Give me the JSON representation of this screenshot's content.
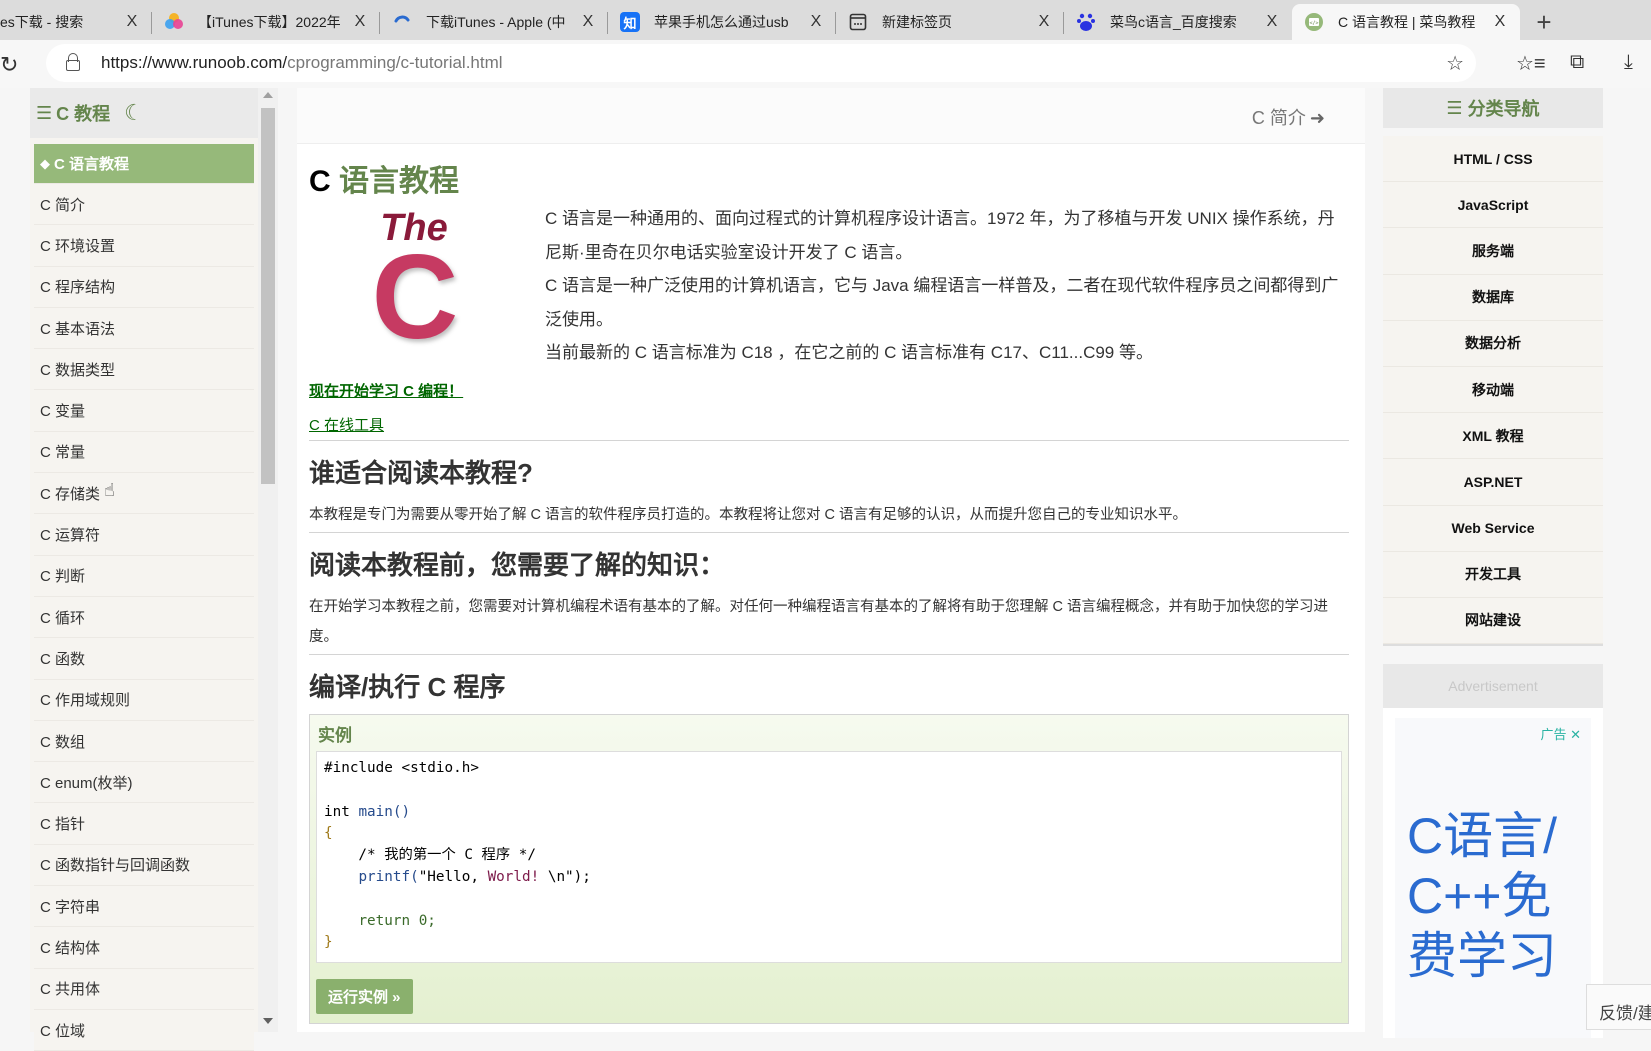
{
  "browser": {
    "tabs": [
      {
        "title": "es下载 - 搜索",
        "favicon": "search-favicon",
        "active": false
      },
      {
        "title": "【iTunes下载】2022年",
        "favicon": "colorful-app-favicon",
        "active": false
      },
      {
        "title": "下载iTunes - Apple (中",
        "favicon": "apple-favicon",
        "active": false
      },
      {
        "title": "苹果手机怎么通过usb",
        "favicon": "zhihu-favicon",
        "active": false
      },
      {
        "title": "新建标签页",
        "favicon": "new-tab-favicon",
        "active": false
      },
      {
        "title": "菜鸟c语言_百度搜索",
        "favicon": "baidu-favicon",
        "active": false
      },
      {
        "title": "C 语言教程 | 菜鸟教程",
        "favicon": "runoob-favicon",
        "active": true
      }
    ],
    "zhihu_glyph": "知",
    "close_glyph": "X",
    "new_tab_glyph": "+",
    "url_host": "https://www.runoob.com/",
    "url_path": "cprogramming/c-tutorial.html"
  },
  "left_nav": {
    "title": "C 教程",
    "items": [
      {
        "label": "C 语言教程",
        "active": true
      },
      {
        "label": "C 简介"
      },
      {
        "label": "C 环境设置"
      },
      {
        "label": "C 程序结构"
      },
      {
        "label": "C 基本语法"
      },
      {
        "label": "C 数据类型"
      },
      {
        "label": "C 变量"
      },
      {
        "label": "C 常量"
      },
      {
        "label": "C 存储类"
      },
      {
        "label": "C 运算符"
      },
      {
        "label": "C 判断"
      },
      {
        "label": "C 循环"
      },
      {
        "label": "C 函数"
      },
      {
        "label": "C 作用域规则"
      },
      {
        "label": "C 数组"
      },
      {
        "label": "C enum(枚举)"
      },
      {
        "label": "C 指针"
      },
      {
        "label": "C 函数指针与回调函数"
      },
      {
        "label": "C 字符串"
      },
      {
        "label": "C 结构体"
      },
      {
        "label": "C 共用体"
      },
      {
        "label": "C 位域"
      }
    ]
  },
  "content": {
    "next_link": "C 简介",
    "title_prefix": "C",
    "title_main": "语言教程",
    "logo_the": "The",
    "logo_c": "C",
    "intro": [
      "C 语言是一种通用的、面向过程式的计算机程序设计语言。1972 年，为了移植与开发 UNIX 操作系统，丹尼斯·里奇在贝尔电话实验室设计开发了 C 语言。",
      "C 语言是一种广泛使用的计算机语言，它与 Java 编程语言一样普及，二者在现代软件程序员之间都得到广泛使用。",
      "当前最新的 C 语言标准为 C18 ，在它之前的 C 语言标准有 C17、C11...C99 等。"
    ],
    "link_start": "现在开始学习 C 编程！",
    "link_tools": "C 在线工具",
    "sections": [
      {
        "heading": "谁适合阅读本教程?",
        "text": "本教程是专门为需要从零开始了解 C 语言的软件程序员打造的。本教程将让您对 C 语言有足够的认识，从而提升您自己的专业知识水平。"
      },
      {
        "heading": "阅读本教程前，您需要了解的知识：",
        "text": "在开始学习本教程之前，您需要对计算机编程术语有基本的了解。对任何一种编程语言有基本的了解将有助于您理解 C 语言编程概念，并有助于加快您的学习进度。"
      },
      {
        "heading": "编译/执行 C 程序"
      }
    ],
    "example": {
      "title": "实例",
      "code_lines": [
        "#include <stdio.h>",
        "",
        "int main()",
        "{",
        "    /* 我的第一个 C 程序 */",
        "    printf(\"Hello, World! \\n\");",
        "",
        "    return 0;",
        "}"
      ],
      "run_button": "运行实例 »"
    }
  },
  "right_nav": {
    "title": "分类导航",
    "items": [
      "HTML / CSS",
      "JavaScript",
      "服务端",
      "数据库",
      "数据分析",
      "移动端",
      "XML 教程",
      "ASP.NET",
      "Web Service",
      "开发工具",
      "网站建设"
    ],
    "ad_label": "Advertisement",
    "ad_tag": "广告",
    "ad_text": "C语言/C++免费学习"
  },
  "feedback_label": "反馈/建议",
  "colors": {
    "brand_green": "#64854c",
    "active_item_bg": "#96b97a",
    "link_green": "#006600",
    "ad_blue": "#2a6bd0"
  }
}
